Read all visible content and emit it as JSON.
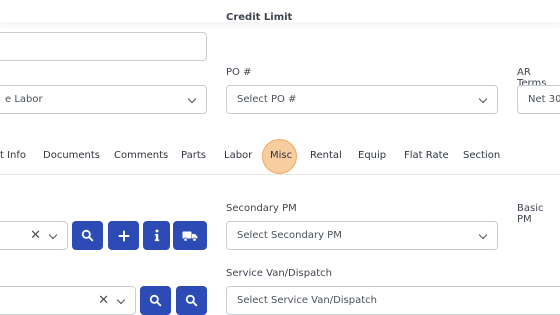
{
  "header": {
    "credit_limit_label": "Credit Limit"
  },
  "row1": {
    "labor_select_value": "e Labor",
    "po_label": "PO #",
    "po_placeholder": "Select PO #",
    "ar_terms_label": "AR Terms",
    "ar_terms_value": "Net 30"
  },
  "tabs": [
    {
      "label": "t Info"
    },
    {
      "label": "Documents"
    },
    {
      "label": "Comments"
    },
    {
      "label": "Parts"
    },
    {
      "label": "Labor"
    },
    {
      "label": "Misc"
    },
    {
      "label": "Rental"
    },
    {
      "label": "Equip"
    },
    {
      "label": "Flat Rate"
    },
    {
      "label": "Section"
    }
  ],
  "active_tab": "Misc",
  "row2": {
    "secondary_pm_label": "Secondary PM",
    "secondary_pm_placeholder": "Select Secondary PM",
    "basic_pm_label": "Basic PM"
  },
  "row3": {
    "service_van_label": "Service Van/Dispatch",
    "service_van_placeholder": "Select Service Van/Dispatch"
  },
  "colors": {
    "button_blue": "#2c4bb5",
    "tab_highlight": "#f8cd9f"
  },
  "icons": [
    "search-icon",
    "plus-icon",
    "info-icon",
    "truck-icon",
    "clear-icon",
    "chevron-down-icon"
  ]
}
